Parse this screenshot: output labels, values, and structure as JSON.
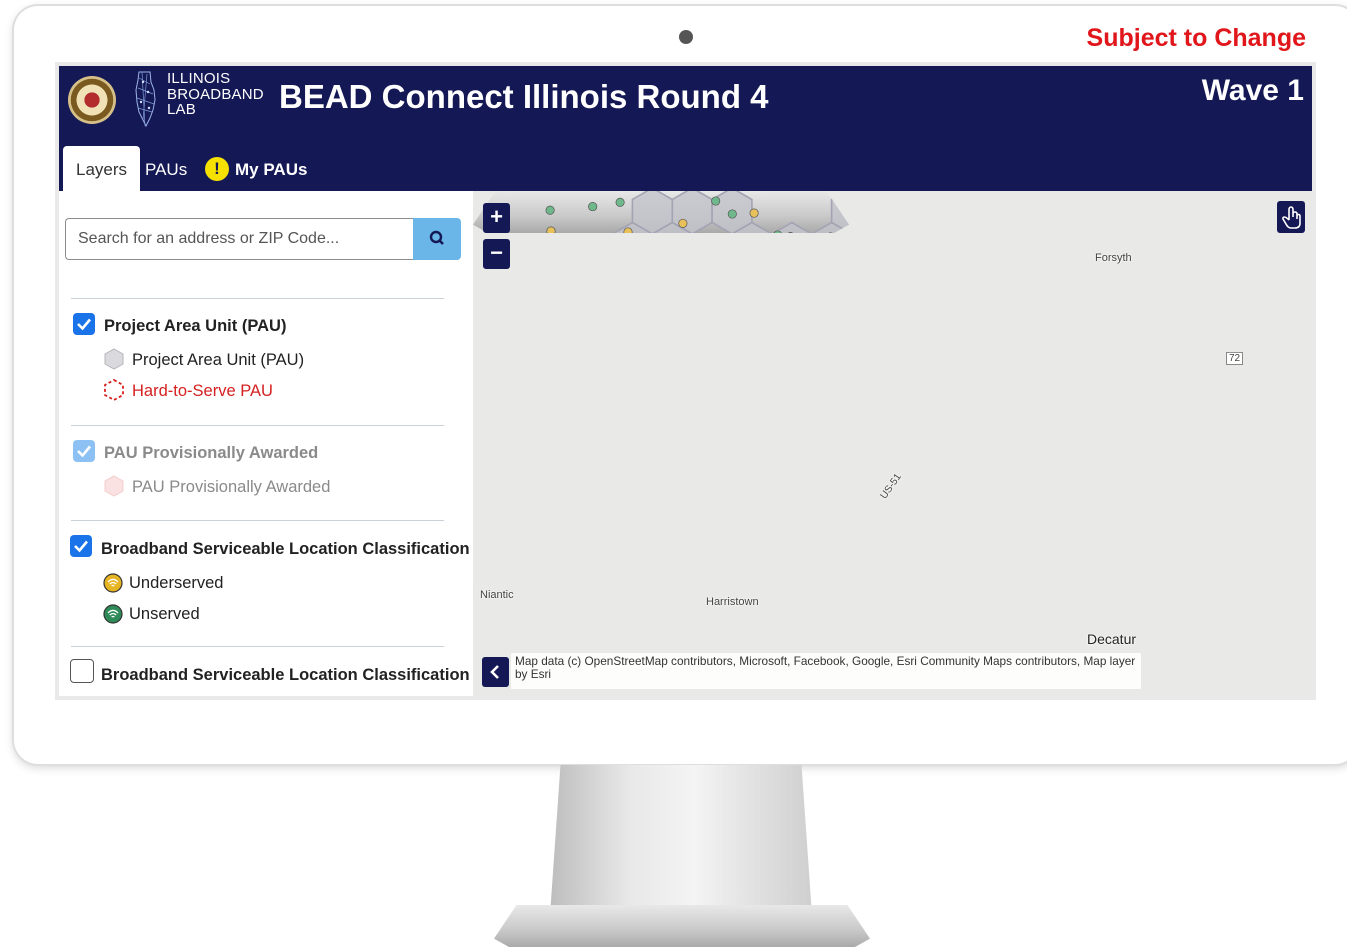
{
  "banner": {
    "subject_to_change": "Subject to Change"
  },
  "header": {
    "logo_text_line1": "ILLINOIS",
    "logo_text_line2": "BROADBAND",
    "logo_text_line3": "LAB",
    "title": "BEAD Connect Illinois Round 4",
    "wave": "Wave 1",
    "colors": {
      "header_bg": "#141854",
      "accent": "#1a73e8",
      "warn": "#f5e000"
    }
  },
  "tabs": [
    {
      "label": "Layers",
      "active": true
    },
    {
      "label": "PAUs",
      "active": false
    },
    {
      "label": "My PAUs",
      "active": false,
      "icon": "warning-icon"
    }
  ],
  "sidebar": {
    "search_placeholder": "Search for an address or ZIP Code...",
    "sections": [
      {
        "label": "Project Area Unit (PAU)",
        "checked": true,
        "items": [
          {
            "label": "Project Area Unit (PAU)",
            "icon": "gray-hexagon-icon"
          },
          {
            "label": "Hard-to-Serve PAU",
            "icon": "red-dashed-hexagon-icon"
          }
        ]
      },
      {
        "label": "PAU Provisionally Awarded",
        "checked": true,
        "disabled": true,
        "items": [
          {
            "label": "PAU Provisionally Awarded",
            "icon": "pink-hexagon-icon"
          }
        ]
      },
      {
        "label": "Broadband Serviceable Location Classification",
        "checked": true,
        "items": [
          {
            "label": "Underserved",
            "icon": "yellow-wifi-circle-icon"
          },
          {
            "label": "Unserved",
            "icon": "green-wifi-circle-icon"
          }
        ]
      },
      {
        "label": "Broadband Serviceable Location Classification",
        "checked": false
      }
    ]
  },
  "map": {
    "zoom_in": "+",
    "zoom_out": "−",
    "places": [
      "Forsyth",
      "Harristown",
      "Niantic",
      "Decatur"
    ],
    "highways": [
      "72",
      "51"
    ],
    "road_label": "US-51",
    "attribution": "Map data (c) OpenStreetMap contributors, Microsoft, Facebook, Google, Esri Community Maps contributors, Map layer by Esri"
  }
}
